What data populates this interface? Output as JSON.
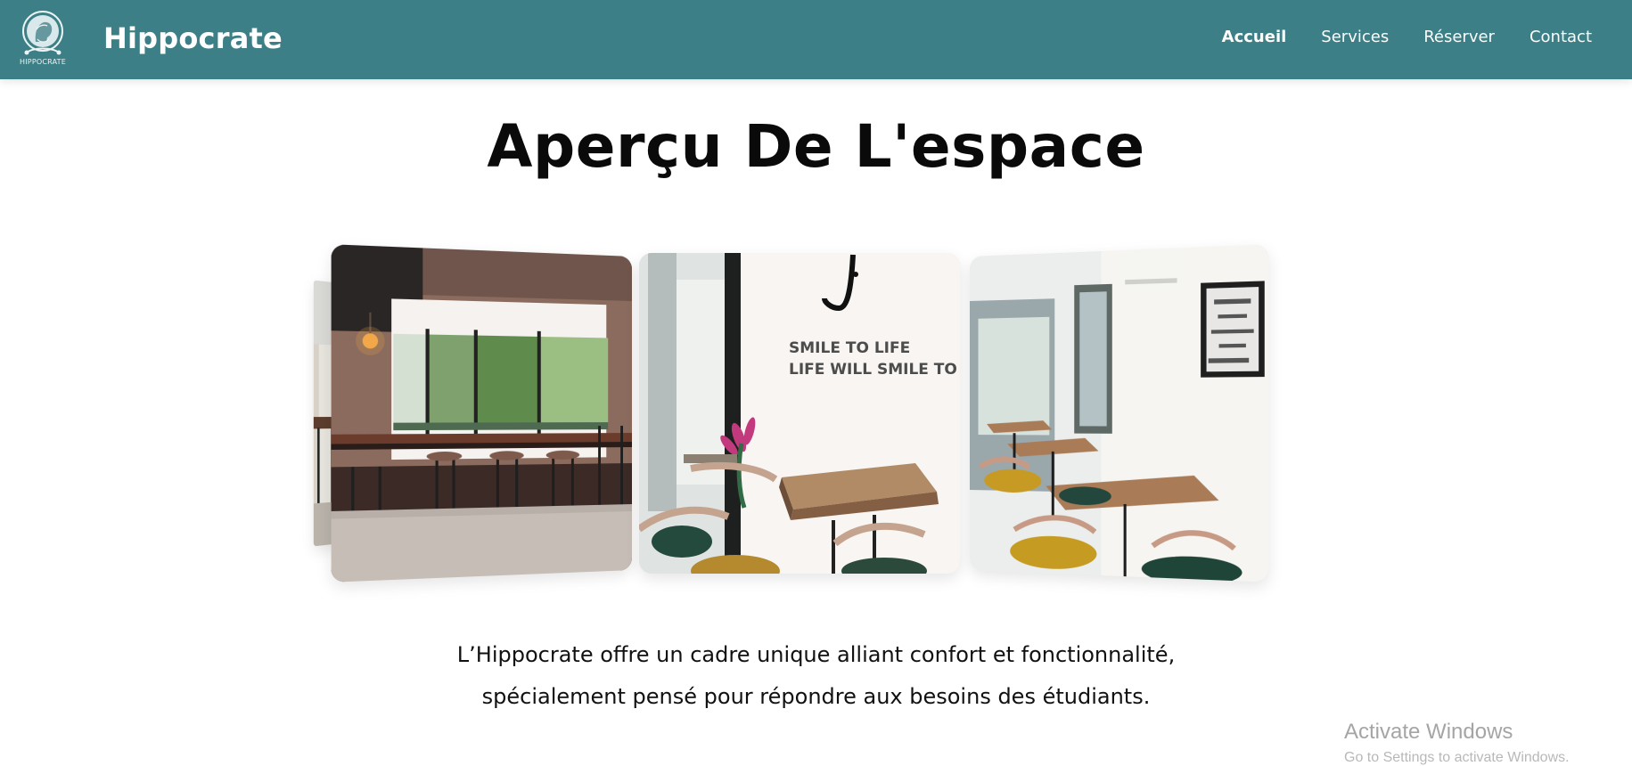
{
  "header": {
    "brand_name": "Hippocrate",
    "logo_caption": "HIPPOCRATE",
    "nav": [
      {
        "label": "Accueil",
        "active": true
      },
      {
        "label": "Services",
        "active": false
      },
      {
        "label": "Réserver",
        "active": false
      },
      {
        "label": "Contact",
        "active": false
      }
    ],
    "background_color": "#3d7f86"
  },
  "main": {
    "title": "Aperçu De L'espace",
    "carousel": {
      "slides": [
        {
          "position": "far-left",
          "subject": "dining room"
        },
        {
          "position": "left",
          "subject": "café room with window and bar stools"
        },
        {
          "position": "center",
          "subject": "table and chairs with wall slogan",
          "wall_text": [
            "SMILE TO LIFE",
            "LIFE WILL SMILE TO YOU"
          ]
        },
        {
          "position": "right",
          "subject": "café room with tables and framed poster"
        }
      ]
    },
    "description": [
      "L’Hippocrate offre un cadre unique alliant confort et fonctionnalité,",
      "spécialement pensé pour répondre aux besoins des étudiants."
    ]
  },
  "watermark": {
    "title": "Activate Windows",
    "subtitle": "Go to Settings to activate Windows."
  }
}
